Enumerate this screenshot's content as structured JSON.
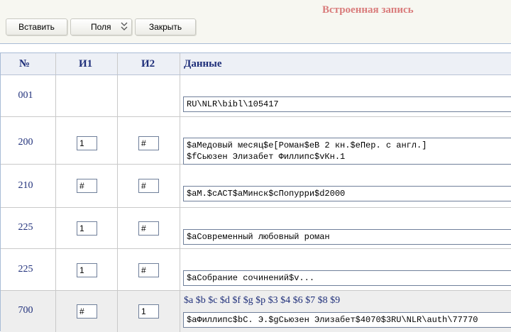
{
  "toolbar": {
    "title": "Встроенная запись",
    "insert_label": "Вставить",
    "fields_label": "Поля",
    "close_label": "Закрыть"
  },
  "table": {
    "headers": {
      "num": "№",
      "i1": "И1",
      "i2": "И2",
      "data": "Данные"
    },
    "rows": [
      {
        "num": "001",
        "i1": "",
        "i2": "",
        "data_lines": [
          "RU\\NLR\\bibl\\105417"
        ]
      },
      {
        "num": "200",
        "i1": "1",
        "i2": "#",
        "data_lines": [
          "$aМедовый месяц$e[Роман$eВ 2 кн.$eПер. с англ.]",
          "$fСьюзен Элизабет Филлипс$vКн.1"
        ]
      },
      {
        "num": "210",
        "i1": "#",
        "i2": "#",
        "data_lines": [
          "$aМ.$cACT$aМинск$cПопурри$d2000"
        ]
      },
      {
        "num": "225",
        "i1": "1",
        "i2": "#",
        "data_lines": [
          "$aСовременный любовный роман"
        ]
      },
      {
        "num": "225",
        "i1": "1",
        "i2": "#",
        "data_lines": [
          "$aСобрание сочинений$v..."
        ]
      },
      {
        "num": "700",
        "i1": "#",
        "i2": "1",
        "subfields": "$a $b $c $d $f $g $p $3 $4 $6 $7 $8 $9",
        "data_lines": [
          "$aФиллипс$bС. Э.$gСьюзен Элизабет$4070$3RU\\NLR\\auth\\77770"
        ]
      }
    ]
  }
}
